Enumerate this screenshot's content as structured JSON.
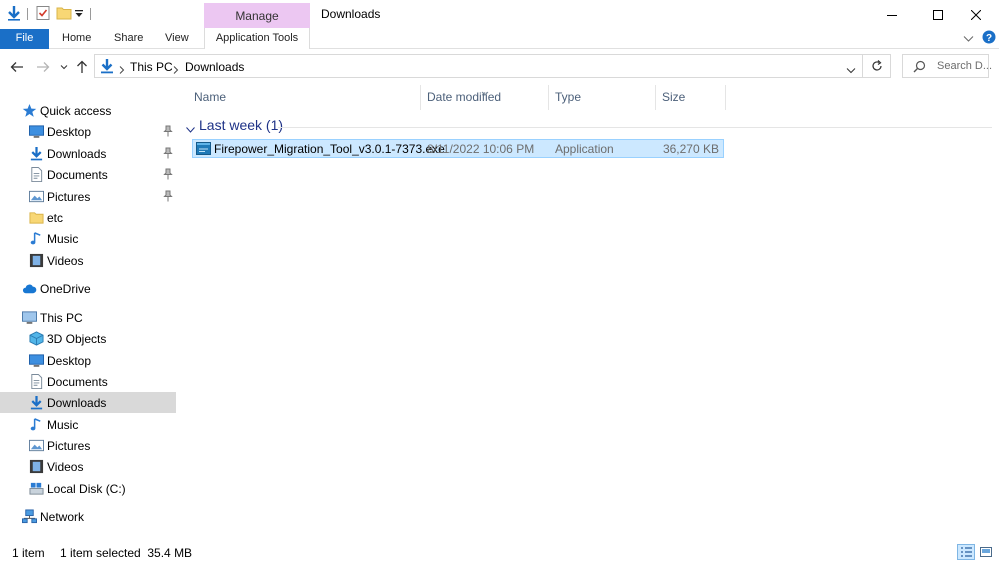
{
  "title_bar": {
    "window_title": "Downloads",
    "context_tab": "Manage",
    "icons": [
      "down-arrow-icon",
      "properties-icon",
      "new-folder-icon",
      "customize-dropdown-icon"
    ],
    "window_controls": [
      "minimize-icon",
      "maximize-icon",
      "close-icon"
    ]
  },
  "ribbon": {
    "file": "File",
    "tabs": [
      "Home",
      "Share",
      "View"
    ],
    "context_subtab": "Application Tools",
    "accent": "#1a6fc7",
    "context_color": "#ecc7f2"
  },
  "address_bar": {
    "crumbs": [
      "This PC",
      "Downloads"
    ],
    "search_placeholder": "Search D..."
  },
  "sidebar": {
    "items": [
      {
        "label": "Quick access",
        "icon": "star-icon"
      },
      {
        "label": "Desktop",
        "icon": "desktop-icon",
        "pinned": true
      },
      {
        "label": "Downloads",
        "icon": "download-icon",
        "pinned": true
      },
      {
        "label": "Documents",
        "icon": "document-icon",
        "pinned": true
      },
      {
        "label": "Pictures",
        "icon": "pictures-icon",
        "pinned": true
      },
      {
        "label": "etc",
        "icon": "folder-icon"
      },
      {
        "label": "Music",
        "icon": "music-icon"
      },
      {
        "label": "Videos",
        "icon": "video-icon"
      },
      {
        "label": "OneDrive",
        "icon": "cloud-icon"
      },
      {
        "label": "This PC",
        "icon": "computer-icon"
      },
      {
        "label": "3D Objects",
        "icon": "cube-icon"
      },
      {
        "label": "Desktop",
        "icon": "desktop-icon"
      },
      {
        "label": "Documents",
        "icon": "document-icon"
      },
      {
        "label": "Downloads",
        "icon": "download-icon",
        "selected": true
      },
      {
        "label": "Music",
        "icon": "music-icon"
      },
      {
        "label": "Pictures",
        "icon": "pictures-icon"
      },
      {
        "label": "Videos",
        "icon": "video-icon"
      },
      {
        "label": "Local Disk (C:)",
        "icon": "drive-icon"
      },
      {
        "label": "Network",
        "icon": "network-icon"
      }
    ]
  },
  "file_list": {
    "columns": [
      "Name",
      "Date modified",
      "Type",
      "Size"
    ],
    "group": "Last week (1)",
    "files": [
      {
        "name": "Firepower_Migration_Tool_v3.0.1-7373.exe",
        "date": "8/11/2022 10:06 PM",
        "type": "Application",
        "size": "36,270 KB",
        "selected": true
      }
    ]
  },
  "status_bar": {
    "count": "1 item",
    "selection": "1 item selected  35.4 MB"
  }
}
